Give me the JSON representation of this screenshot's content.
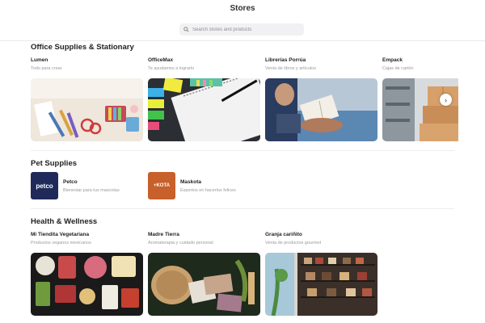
{
  "header": {
    "title": "Stores",
    "search_placeholder": "Search stores and products"
  },
  "sections": {
    "office": {
      "title": "Office Supplies & Stationary",
      "stores": [
        {
          "name": "Lumen",
          "desc": "Todo para crear"
        },
        {
          "name": "OfficeMax",
          "desc": "Te ayudamos a lograrlo"
        },
        {
          "name": "Librerías Porrúa",
          "desc": "Venta de libros y artículos"
        },
        {
          "name": "Empack",
          "desc": "Cajas de cartón"
        }
      ]
    },
    "pet": {
      "title": "Pet Supplies",
      "stores": [
        {
          "name": "Petco",
          "desc": "Bienestar para tus mascotas",
          "logo_text": "petco",
          "logo_color": "#1f2a5a"
        },
        {
          "name": "Maskota",
          "desc": "Expertos en hacerlos felices",
          "logo_text": "+KOTA",
          "logo_color": "#c7602a"
        }
      ]
    },
    "health": {
      "title": "Health & Wellness",
      "stores": [
        {
          "name": "Mi Tiendita Vegetariana",
          "desc": "Productos veganos mexicanos"
        },
        {
          "name": "Madre Tierra",
          "desc": "Aromaterapia y cuidado personal"
        },
        {
          "name": "Granja cariñito",
          "desc": "Venta de productos gourmet"
        }
      ]
    }
  },
  "next_label": "›"
}
